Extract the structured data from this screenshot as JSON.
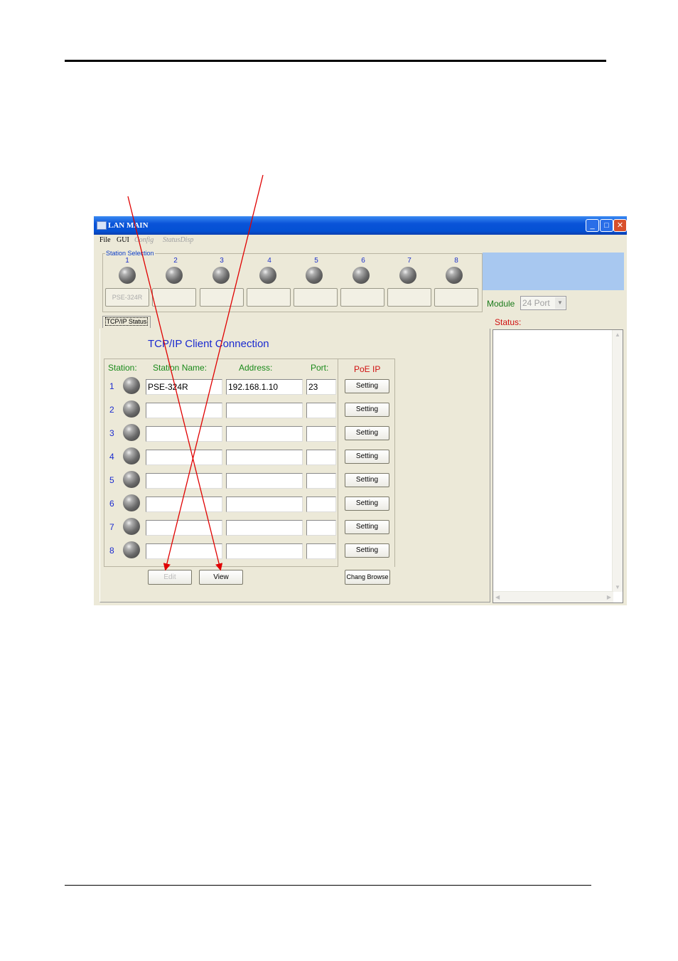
{
  "window": {
    "title": "LAN MAIN"
  },
  "menu": [
    {
      "label": "File",
      "enabled": true
    },
    {
      "label": "GUI",
      "enabled": true
    },
    {
      "label": "Config",
      "enabled": false
    },
    {
      "label": "StatusDisp",
      "enabled": false
    }
  ],
  "station_selection": {
    "label": "Station Selection",
    "numbers": [
      "1",
      "2",
      "3",
      "4",
      "5",
      "6",
      "7",
      "8"
    ],
    "buttons": [
      "PSE-324R",
      "",
      "",
      "",
      "",
      "",
      "",
      ""
    ]
  },
  "module": {
    "label": "Module",
    "value": "24 Port"
  },
  "tab": {
    "label": "TCP/IP Status"
  },
  "main": {
    "title": "TCP/IP Client Connection",
    "columns": {
      "station": "Station:",
      "name": "Station Name:",
      "address": "Address:",
      "port": "Port:",
      "poe": "PoE IP"
    },
    "rows": [
      {
        "num": "1",
        "name": "PSE-324R",
        "address": "192.168.1.10",
        "port": "23",
        "button": "Setting"
      },
      {
        "num": "2",
        "name": "",
        "address": "",
        "port": "",
        "button": "Setting"
      },
      {
        "num": "3",
        "name": "",
        "address": "",
        "port": "",
        "button": "Setting"
      },
      {
        "num": "4",
        "name": "",
        "address": "",
        "port": "",
        "button": "Setting"
      },
      {
        "num": "5",
        "name": "",
        "address": "",
        "port": "",
        "button": "Setting"
      },
      {
        "num": "6",
        "name": "",
        "address": "",
        "port": "",
        "button": "Setting"
      },
      {
        "num": "7",
        "name": "",
        "address": "",
        "port": "",
        "button": "Setting"
      },
      {
        "num": "8",
        "name": "",
        "address": "",
        "port": "",
        "button": "Setting"
      }
    ],
    "buttons": {
      "edit": "Edit",
      "view": "View",
      "browse": "Chang Browse"
    }
  },
  "status": {
    "label": "Status:"
  },
  "colors": {
    "title_blue": "#1a2ad0",
    "header_green": "#1a8a1a",
    "poe_red": "#d01010",
    "annotation_arrow": "#e00000"
  }
}
